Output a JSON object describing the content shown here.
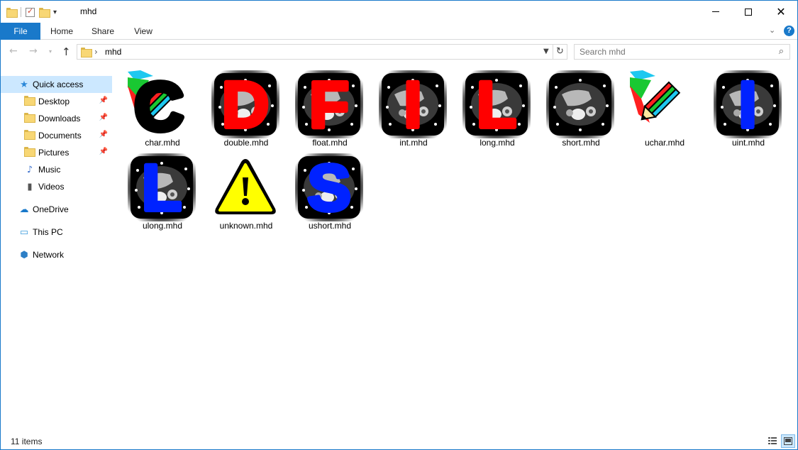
{
  "window": {
    "title": "mhd",
    "controls": {
      "minimize": "minimize",
      "maximize": "maximize",
      "close": "close"
    }
  },
  "ribbon": {
    "tabs": [
      {
        "label": "File"
      },
      {
        "label": "Home"
      },
      {
        "label": "Share"
      },
      {
        "label": "View"
      }
    ],
    "help_label": "?"
  },
  "address": {
    "path": "mhd",
    "separator": "›"
  },
  "search": {
    "placeholder": "Search mhd"
  },
  "nav": {
    "quick_access": "Quick access",
    "pinned": [
      {
        "label": "Desktop",
        "icon": "desktop-folder-icon"
      },
      {
        "label": "Downloads",
        "icon": "downloads-folder-icon"
      },
      {
        "label": "Documents",
        "icon": "documents-folder-icon"
      },
      {
        "label": "Pictures",
        "icon": "pictures-folder-icon"
      },
      {
        "label": "Music",
        "icon": "music-folder-icon"
      },
      {
        "label": "Videos",
        "icon": "videos-folder-icon"
      }
    ],
    "onedrive": "OneDrive",
    "this_pc": "This PC",
    "network": "Network"
  },
  "files": [
    {
      "name": "char.mhd",
      "letter": "C",
      "color": "#000000",
      "style": "pencil"
    },
    {
      "name": "double.mhd",
      "letter": "D",
      "color": "#ff0000",
      "style": "ct"
    },
    {
      "name": "float.mhd",
      "letter": "F",
      "color": "#ff0000",
      "style": "ct"
    },
    {
      "name": "int.mhd",
      "letter": "I",
      "color": "#ff0000",
      "style": "ct"
    },
    {
      "name": "long.mhd",
      "letter": "L",
      "color": "#ff0000",
      "style": "ct"
    },
    {
      "name": "short.mhd",
      "letter": "",
      "color": "",
      "style": "ct"
    },
    {
      "name": "uchar.mhd",
      "letter": "",
      "color": "",
      "style": "pencil-only"
    },
    {
      "name": "uint.mhd",
      "letter": "I",
      "color": "#0022ff",
      "style": "ct"
    },
    {
      "name": "ulong.mhd",
      "letter": "L",
      "color": "#0022ff",
      "style": "ct"
    },
    {
      "name": "unknown.mhd",
      "letter": "!",
      "color": "#ffff00",
      "style": "warning"
    },
    {
      "name": "ushort.mhd",
      "letter": "S",
      "color": "#0022ff",
      "style": "ct"
    }
  ],
  "status": {
    "item_count": "11 items"
  },
  "colors": {
    "accent": "#1979ca",
    "selected_bg": "#cce8ff",
    "signed_letter": "#ff0000",
    "unsigned_letter": "#0022ff"
  }
}
